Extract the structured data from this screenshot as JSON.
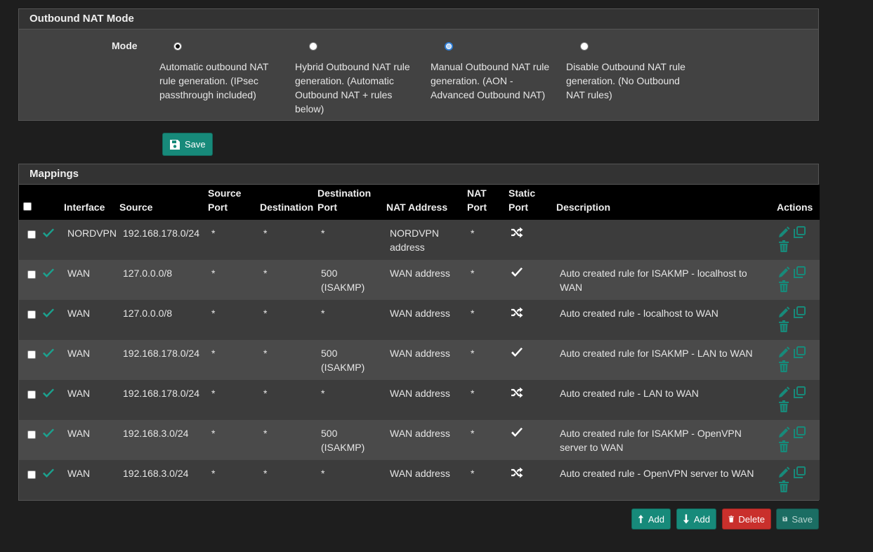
{
  "mode_panel": {
    "heading": "Outbound NAT Mode",
    "label": "Mode",
    "options": [
      {
        "label": "Automatic outbound NAT rule generation. (IPsec passthrough included)",
        "checked": true
      },
      {
        "label": "Hybrid Outbound NAT rule generation. (Automatic Outbound NAT + rules below)",
        "checked": false
      },
      {
        "label": "Manual Outbound NAT rule generation. (AON - Advanced Outbound NAT)",
        "checked": false,
        "focused": true
      },
      {
        "label": "Disable Outbound NAT rule generation. (No Outbound NAT rules)",
        "checked": false
      }
    ],
    "save_label": "Save"
  },
  "mappings": {
    "heading": "Mappings",
    "columns": {
      "interface": "Interface",
      "source": "Source",
      "source_port": "Source Port",
      "destination": "Destination",
      "destination_port": "Destination Port",
      "nat_address": "NAT Address",
      "nat_port": "NAT Port",
      "static_port": "Static Port",
      "description": "Description",
      "actions": "Actions"
    },
    "rows": [
      {
        "interface": "NORDVPN",
        "source": "192.168.178.0/24",
        "source_port": "*",
        "destination": "*",
        "destination_port": "*",
        "nat_address": "NORDVPN address",
        "nat_port": "*",
        "static_port": "shuffle-icon",
        "description": ""
      },
      {
        "interface": "WAN",
        "source": "127.0.0.0/8",
        "source_port": "*",
        "destination": "*",
        "destination_port": "500 (ISAKMP)",
        "nat_address": "WAN address",
        "nat_port": "*",
        "static_port": "check-icon",
        "description": "Auto created rule for ISAKMP - localhost to WAN"
      },
      {
        "interface": "WAN",
        "source": "127.0.0.0/8",
        "source_port": "*",
        "destination": "*",
        "destination_port": "*",
        "nat_address": "WAN address",
        "nat_port": "*",
        "static_port": "shuffle-icon",
        "description": "Auto created rule - localhost to WAN"
      },
      {
        "interface": "WAN",
        "source": "192.168.178.0/24",
        "source_port": "*",
        "destination": "*",
        "destination_port": "500 (ISAKMP)",
        "nat_address": "WAN address",
        "nat_port": "*",
        "static_port": "check-icon",
        "description": "Auto created rule for ISAKMP - LAN to WAN"
      },
      {
        "interface": "WAN",
        "source": "192.168.178.0/24",
        "source_port": "*",
        "destination": "*",
        "destination_port": "*",
        "nat_address": "WAN address",
        "nat_port": "*",
        "static_port": "shuffle-icon",
        "description": "Auto created rule - LAN to WAN"
      },
      {
        "interface": "WAN",
        "source": "192.168.3.0/24",
        "source_port": "*",
        "destination": "*",
        "destination_port": "500 (ISAKMP)",
        "nat_address": "WAN address",
        "nat_port": "*",
        "static_port": "check-icon",
        "description": "Auto created rule for ISAKMP - OpenVPN server to WAN"
      },
      {
        "interface": "WAN",
        "source": "192.168.3.0/24",
        "source_port": "*",
        "destination": "*",
        "destination_port": "*",
        "nat_address": "WAN address",
        "nat_port": "*",
        "static_port": "shuffle-icon",
        "description": "Auto created rule - OpenVPN server to WAN"
      }
    ]
  },
  "bottom_buttons": {
    "add_top": "Add",
    "add_bottom": "Add",
    "delete": "Delete",
    "save": "Save"
  },
  "colors": {
    "accent": "#178a7a",
    "danger": "#c9302c",
    "enabled_check": "#1ba18e"
  }
}
